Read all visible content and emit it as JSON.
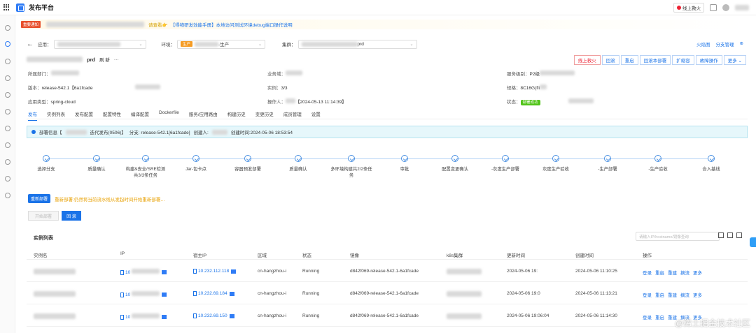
{
  "header": {
    "title": "发布平台",
    "online_btn": "线上救火"
  },
  "notice": {
    "tag": "重要通知",
    "text": "请查看👉",
    "link": "【得物研发效能手册】本地访问测试环境debug端口操作说明"
  },
  "filters": {
    "app_label": "应用：",
    "env_label": "环境：",
    "env_tag": "生产",
    "env_value": "-生产",
    "cluster_label": "集群：",
    "cluster_value": "prd",
    "links": [
      "火焰图",
      "分支管理"
    ]
  },
  "title": {
    "name": "prd",
    "refresh": "刷 新",
    "more": "···"
  },
  "actions": [
    "线上救火",
    "回滚",
    "重启",
    "回滚本部署",
    "扩缩容",
    "故障操作",
    "更多 ⌄"
  ],
  "info": {
    "dept_label": "所属部门：",
    "business_label": "业务域：",
    "level_label": "服务级别：",
    "level_value": "P2级",
    "version_label": "版本：",
    "version_value": "release-542.1【6a1fcade",
    "instance_label": "实例：",
    "instance_value": "3/3",
    "spec_label": "规格：",
    "spec_value": "8C16G(flt",
    "apptype_label": "应用类型：",
    "apptype_value": "spring-cloud",
    "operator_label": "操作人：",
    "operator_value": "【2024-05-13 11:14:39】",
    "status_label": "状态：",
    "status_value": "部署成功"
  },
  "tabs": [
    "发布",
    "实例列表",
    "发布配置",
    "配置特性",
    "编译配置",
    "Dockerfile",
    "服务/应用路由",
    "构建历史",
    "变更历史",
    "成员管理",
    "设置"
  ],
  "deploy_info": {
    "label": "部署信息【",
    "type": "迭代发布(0506)】",
    "branch": "分支: release-542.1[6a1fcade]",
    "creator": "创建人:",
    "created": "创建时间:2024-05-06 18:53:54"
  },
  "steps": [
    "选择分支",
    "质量确认",
    "构建&安全/SRE检测共3/3条任务",
    "Jar-包卡点",
    "容器预发部署",
    "质量确认",
    "多环境构建共2/2条任务",
    "审批",
    "配置变更确认",
    "-灰度生产部署",
    "灰度生产验收",
    "-生产部署",
    "-生产验收",
    "合入基线"
  ],
  "redeploy": {
    "button": "重新部署",
    "warning": "重新部署:仍然将当前流水线从发起时间开始重新部署…"
  },
  "ops": {
    "end": "开始部署",
    "primary": "回 滚"
  },
  "instance_list": {
    "title": "实例列表",
    "search_placeholder": "请输入IP/hostname/镜像查询",
    "columns": [
      "实例名",
      "IP",
      "宿主IP",
      "区域",
      "状态",
      "镜像",
      "k8s集群",
      "更新时间",
      "创建时间",
      "操作"
    ],
    "rows": [
      {
        "ip": "10",
        "host_ip": "10.232.112.118",
        "region": "cn-hangzhou-i",
        "status": "Running",
        "image": "d842f069-release-542.1-6a1fcade",
        "updated": "2024-05-06 19:",
        "created": "2024-05-06 11:10:25"
      },
      {
        "ip": "10",
        "host_ip": "10.232.69.184",
        "region": "cn-hangzhou-i",
        "status": "Running",
        "image": "d842f069-release-542.1-6a1fcade",
        "updated": "2024-05-06 19:0",
        "created": "2024-05-06 11:13:21"
      },
      {
        "ip": "10",
        "host_ip": "10.232.69.150",
        "region": "cn-hangzhou-i",
        "status": "Running",
        "image": "d842f069-release-542.1-6a1fcade",
        "updated": "2024-05-06 19:06:04",
        "created": "2024-05-06 11:14:30"
      }
    ],
    "row_ops": [
      "登录",
      "重启",
      "重建",
      "摘流",
      "更多"
    ]
  },
  "watermark": "@稀土掘金技术社区"
}
